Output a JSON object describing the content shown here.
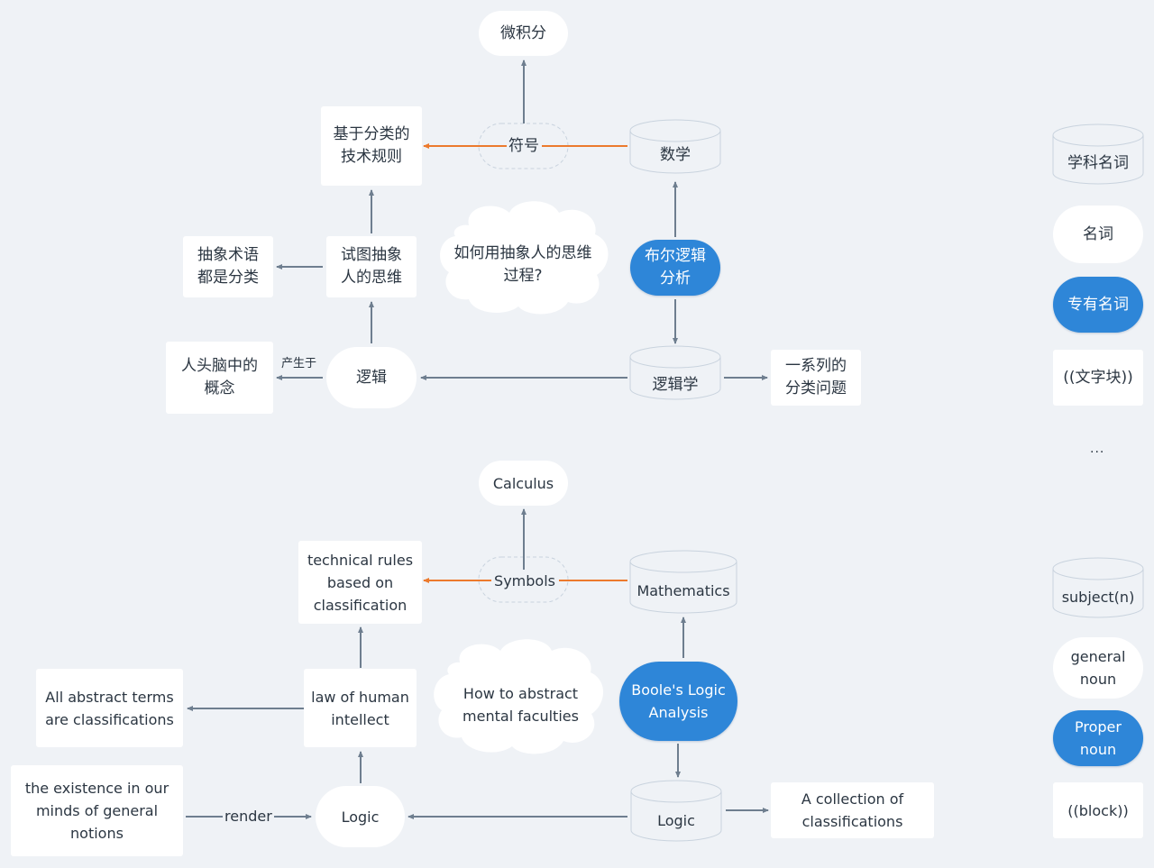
{
  "colors": {
    "background": "#eff2f6",
    "node_fill": "#ffffff",
    "accent_blue": "#2e86d8",
    "edge_gray": "#6e7e8f",
    "edge_orange": "#ec7a2d",
    "outline": "#c9d3de",
    "text": "#2b3642"
  },
  "chinese_diagram": {
    "calculus": "微积分",
    "symbols": "符号",
    "technical_rules": "基于分类的\n技术规则",
    "mathematics": "数学",
    "abstract_terms": "抽象术语\n都是分类",
    "human_thought": "试图抽象\n人的思维",
    "question_cloud": "如何用抽象人的思维\n过程?",
    "boole_analysis": "布尔逻辑\n分析",
    "concepts_in_mind": "人头脑中的\n概念",
    "produced_by_label": "产生于",
    "logic": "逻辑",
    "logic_science": "逻辑学",
    "classification_problems": "一系列的\n分类问题"
  },
  "english_diagram": {
    "calculus": "Calculus",
    "symbols": "Symbols",
    "technical_rules": "technical rules\nbased on\nclassification",
    "mathematics": "Mathematics",
    "abstract_terms": "All abstract terms\nare classifications",
    "human_intellect": "law of human\nintellect",
    "question_cloud": "How to abstract\nmental faculties",
    "boole_analysis": "Boole's Logic\nAnalysis",
    "general_notions": "the existence in our\nminds of general\nnotions",
    "render_label": "render",
    "logic": "Logic",
    "logic_cylinder": "Logic",
    "classifications": "A collection of\nclassifications"
  },
  "legend_chinese": {
    "subject_noun": "学科名词",
    "noun": "名词",
    "proper_noun": "专有名词",
    "text_block": "((文字块))",
    "more": "..."
  },
  "legend_english": {
    "subject_noun": "subject(n)",
    "noun": "general\nnoun",
    "proper_noun": "Proper\nnoun",
    "text_block": "((block))"
  }
}
